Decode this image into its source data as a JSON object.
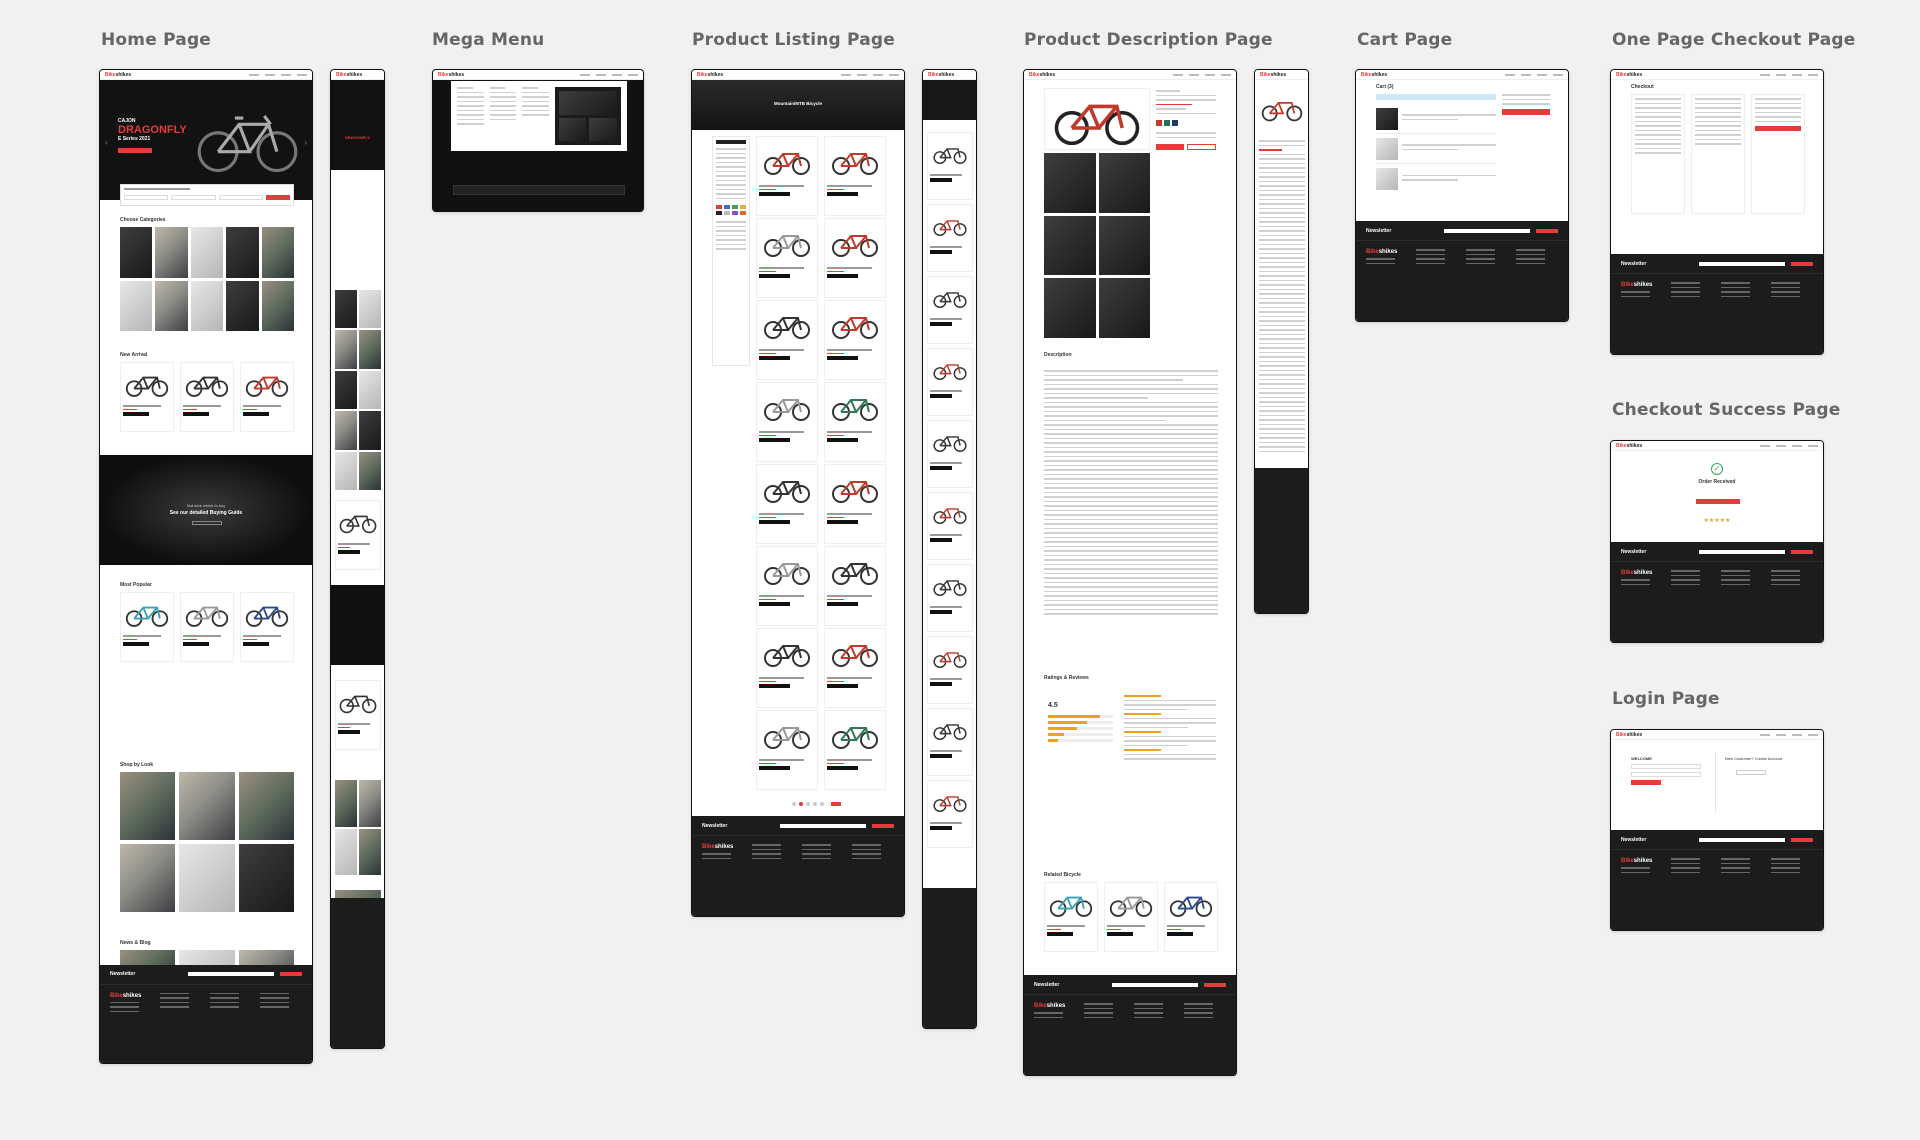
{
  "labels": {
    "home": "Home Page",
    "mega": "Mega Menu",
    "listing": "Product Listing Page",
    "description": "Product Description Page",
    "cart": "Cart Page",
    "checkout": "One Page Checkout Page",
    "success": "Checkout Success Page",
    "login": "Login Page"
  },
  "brand": {
    "prefix": "Bike",
    "suffix": "shikes"
  },
  "home": {
    "hero_small": "CAJON",
    "hero_title": "DRAGONFLY",
    "hero_sub": "E Series 2021",
    "categories_title": "Choose Categories",
    "new_arrival_title": "New Arrival",
    "banner_small": "Not sure which to buy",
    "banner_title": "See our detailed Buying Guide",
    "most_popular_title": "Most Popular",
    "shop_by_look_title": "Shop by Look",
    "news_title": "News & Blog"
  },
  "listing": {
    "hero_title": "Mountain/MTB Bicycle"
  },
  "description": {
    "description_title": "Description",
    "ratings_title": "Ratings & Reviews",
    "rating_value": "4.5",
    "related_title": "Related Bicycle"
  },
  "cart": {
    "title": "Cart (3)"
  },
  "checkout": {
    "title": "Checkout"
  },
  "success": {
    "title": "Order Received"
  },
  "login": {
    "welcome": "WELCOME",
    "new_customer": "New Customer? Create Account"
  },
  "footer": {
    "newsletter": "Newsletter"
  },
  "colors": {
    "accent": "#e63b3b",
    "dark": "#1c1c1c",
    "canvas": "#f1f1f1"
  }
}
